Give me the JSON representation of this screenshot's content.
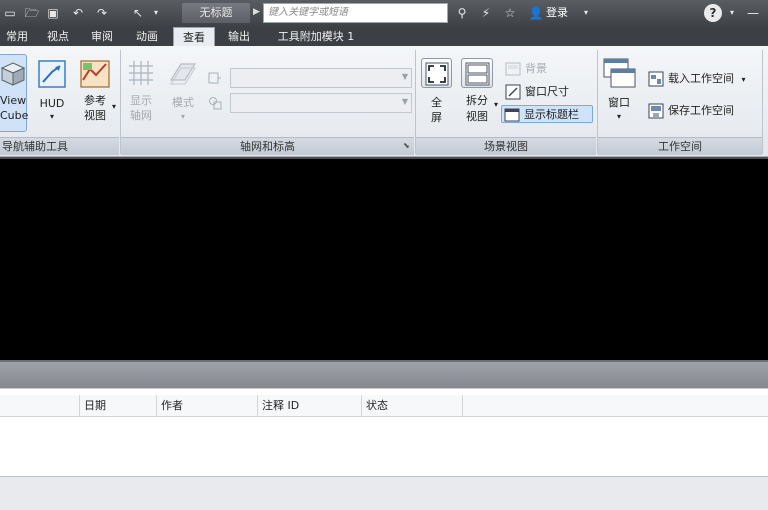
{
  "titlebar": {
    "document_title": "无标题",
    "search_placeholder": "键入关键字或短语",
    "login_label": "登录",
    "help_label": "?"
  },
  "tabs": [
    {
      "label": "常用"
    },
    {
      "label": "视点"
    },
    {
      "label": "审阅"
    },
    {
      "label": "动画"
    },
    {
      "label": "查看",
      "active": true
    },
    {
      "label": "输出"
    },
    {
      "label": "工具附加模块 1"
    }
  ],
  "ribbon": {
    "navigation_aids": {
      "title": "导航辅助工具",
      "viewcube_label": [
        "View",
        "Cube"
      ],
      "hud_label": "HUD",
      "reference_views_label": [
        "参考",
        "视图"
      ]
    },
    "grids_levels": {
      "title": "轴网和标高",
      "show_grid_label": [
        "显示",
        "轴网"
      ],
      "mode_label": "模式"
    },
    "scene_view": {
      "title": "场景视图",
      "fullscreen_label": [
        "全",
        "屏"
      ],
      "split_view_label": [
        "拆分",
        "视图"
      ],
      "background_label": "背景",
      "window_size_label": "窗口尺寸",
      "show_titlebar_label": "显示标题栏"
    },
    "workspace": {
      "title": "工作空间",
      "windows_label": "窗口",
      "load_workspace_label": "载入工作空间",
      "save_workspace_label": "保存工作空间"
    }
  },
  "grid": {
    "columns": [
      "日期",
      "作者",
      "注释 ID",
      "状态"
    ]
  },
  "colors": {
    "titlebar": "#4a4d52",
    "ribbon": "#eef1f4",
    "viewport": "#000000",
    "highlight": "#cfe2f7"
  }
}
